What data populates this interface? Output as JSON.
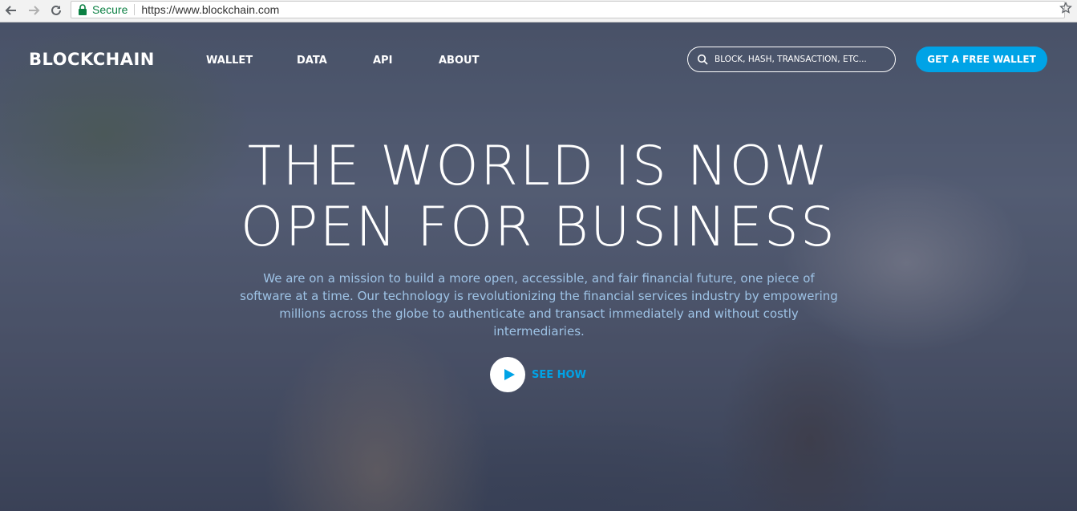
{
  "browser": {
    "secure_label": "Secure",
    "url": "https://www.blockchain.com"
  },
  "nav": {
    "logo": "BLOCKCHAIN",
    "items": [
      {
        "label": "WALLET"
      },
      {
        "label": "DATA"
      },
      {
        "label": "API"
      },
      {
        "label": "ABOUT"
      }
    ],
    "search_placeholder": "BLOCK, HASH, TRANSACTION, ETC...",
    "cta_label": "GET A FREE WALLET"
  },
  "hero": {
    "headline_line1": "THE WORLD IS NOW",
    "headline_line2": "OPEN FOR BUSINESS",
    "mission": "We are on a mission to build a more open, accessible, and fair financial future, one piece of software at a time. Our technology is revolutionizing the financial services industry by empowering millions across the globe to authenticate and transact immediately and without costly intermediaries.",
    "see_how_label": "SEE HOW"
  },
  "colors": {
    "accent": "#00a3e6",
    "mission_text": "#9ec3e6",
    "secure": "#0b8043"
  },
  "icons": [
    "back-arrow-icon",
    "forward-arrow-icon",
    "reload-icon",
    "lock-icon",
    "star-icon",
    "search-icon",
    "play-icon"
  ]
}
